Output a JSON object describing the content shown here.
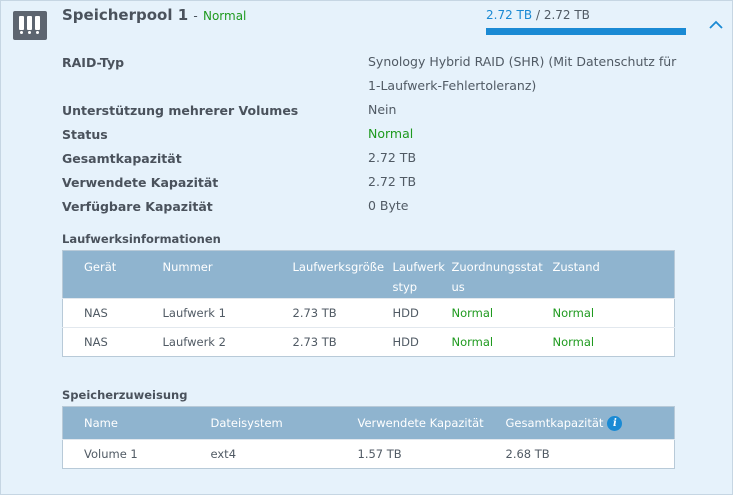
{
  "pool": {
    "name": "Speicherpool 1",
    "separator": "-",
    "status": "Normal",
    "used_capacity": "2.72 TB",
    "capacity_divider": "/",
    "total_capacity": "2.72 TB",
    "usage_fraction": 1.0
  },
  "properties": [
    {
      "label": "RAID-Typ",
      "value": "Synology Hybrid RAID (SHR) (Mit Datenschutz für 1-Laufwerk-Fehlertoleranz)"
    },
    {
      "label": "Unterstützung mehrerer Volumes",
      "value": "Nein"
    },
    {
      "label": "Status",
      "value": "Normal"
    },
    {
      "label": "Gesamtkapazität",
      "value": "2.72 TB"
    },
    {
      "label": "Verwendete Kapazität",
      "value": "2.72 TB"
    },
    {
      "label": "Verfügbare Kapazität",
      "value": "0 Byte"
    }
  ],
  "drives": {
    "title": "Laufwerksinformationen",
    "headers": [
      "Gerät",
      "Nummer",
      "Laufwerksgröße",
      "Laufwerkstyp",
      "Zuordnungsstatus",
      "Zustand"
    ],
    "rows": [
      [
        "NAS",
        "Laufwerk 1",
        "2.73 TB",
        "HDD",
        "Normal",
        "Normal"
      ],
      [
        "NAS",
        "Laufwerk 2",
        "2.73 TB",
        "HDD",
        "Normal",
        "Normal"
      ]
    ]
  },
  "allocation": {
    "title": "Speicherzuweisung",
    "headers": [
      "Name",
      "Dateisystem",
      "Verwendete Kapazität",
      "Gesamtkapazität"
    ],
    "rows": [
      [
        "Volume 1",
        "ext4",
        "1.57 TB",
        "2.68 TB"
      ]
    ]
  },
  "icons": {
    "pool": "storage-pool-icon",
    "collapse": "chevron-up-icon",
    "info": "info-icon"
  },
  "colors": {
    "accent": "#1a8ad4",
    "ok": "#1f9a1f",
    "panel_bg": "#e6f2fb",
    "table_header": "#8fb4cf"
  }
}
